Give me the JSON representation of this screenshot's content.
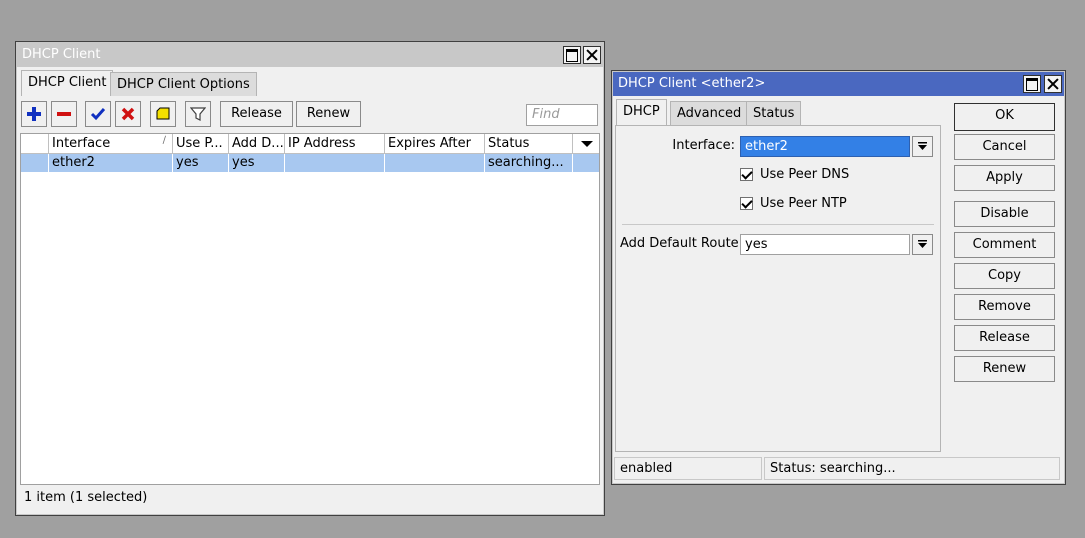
{
  "window_main": {
    "title": "DHCP Client",
    "tabs": [
      "DHCP Client",
      "DHCP Client Options"
    ],
    "toolbar": {
      "add": "add-icon",
      "remove": "remove-icon",
      "enable": "check-icon",
      "disable": "cross-icon",
      "comment": "comment-icon",
      "filter": "filter-icon",
      "release_label": "Release",
      "renew_label": "Renew",
      "find_placeholder": "Find"
    },
    "columns": [
      "Interface",
      "Use P...",
      "Add D...",
      "IP Address",
      "Expires After",
      "Status"
    ],
    "rows": [
      {
        "interface": "ether2",
        "use_peer": "yes",
        "add_default": "yes",
        "ip_address": "",
        "expires_after": "",
        "status": "searching..."
      }
    ],
    "status": "1 item (1 selected)"
  },
  "window_detail": {
    "title": "DHCP Client <ether2>",
    "tabs": [
      "DHCP",
      "Advanced",
      "Status"
    ],
    "interface_label": "Interface:",
    "interface_value": "ether2",
    "use_peer_dns": {
      "label": "Use Peer DNS",
      "checked": true
    },
    "use_peer_ntp": {
      "label": "Use Peer NTP",
      "checked": true
    },
    "default_route_label": "Add Default Route:",
    "default_route_value": "yes",
    "buttons": [
      "OK",
      "Cancel",
      "Apply",
      "Disable",
      "Comment",
      "Copy",
      "Remove",
      "Release",
      "Renew"
    ],
    "status_left": "enabled",
    "status_right": "Status: searching..."
  },
  "colors": {
    "selection": "#a8c8f0",
    "active_title": "#4a68c0",
    "field_selected": "#3380e6",
    "remove_red": "#d01010",
    "add_blue": "#1030c0"
  }
}
